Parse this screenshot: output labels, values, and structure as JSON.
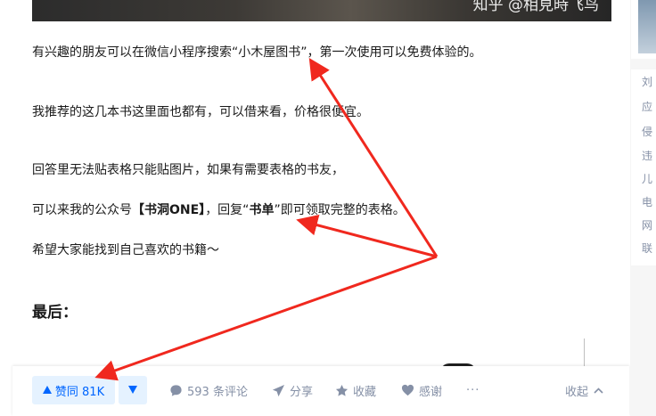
{
  "image_watermark": "知乎 @相見時飞鸟",
  "content": {
    "p1": "有兴趣的朋友可以在微信小程序搜索“小木屋图书”，第一次使用可以免费体验的。",
    "p2": "我推荐的这几本书这里面也都有，可以借来看，价格很便宜。",
    "p3": "回答里无法贴表格只能贴图片，如果有需要表格的书友，",
    "p4_pre": "可以来我的公众号",
    "p4_bold1": "【书洞ONE】",
    "p4_mid": "，回复“",
    "p4_bold2": "书单",
    "p4_post": "”即可领取完整的表格。",
    "p5": "希望大家能找到自己喜欢的书籍～",
    "heading": "最后："
  },
  "actions": {
    "upvote_label": "赞同 81K",
    "comments_label": "593 条评论",
    "share_label": "分享",
    "favorite_label": "收藏",
    "thanks_label": "感谢",
    "more_label": "···",
    "collapse_label": "收起"
  },
  "sidebar": {
    "items": [
      "刘",
      "应",
      "侵",
      "违",
      "儿",
      "电",
      "网",
      "联"
    ]
  },
  "colors": {
    "accent": "#0066ff",
    "accent_bg": "#e5f2ff",
    "muted": "#8590a6",
    "annotation_arrow": "#f0281e"
  }
}
